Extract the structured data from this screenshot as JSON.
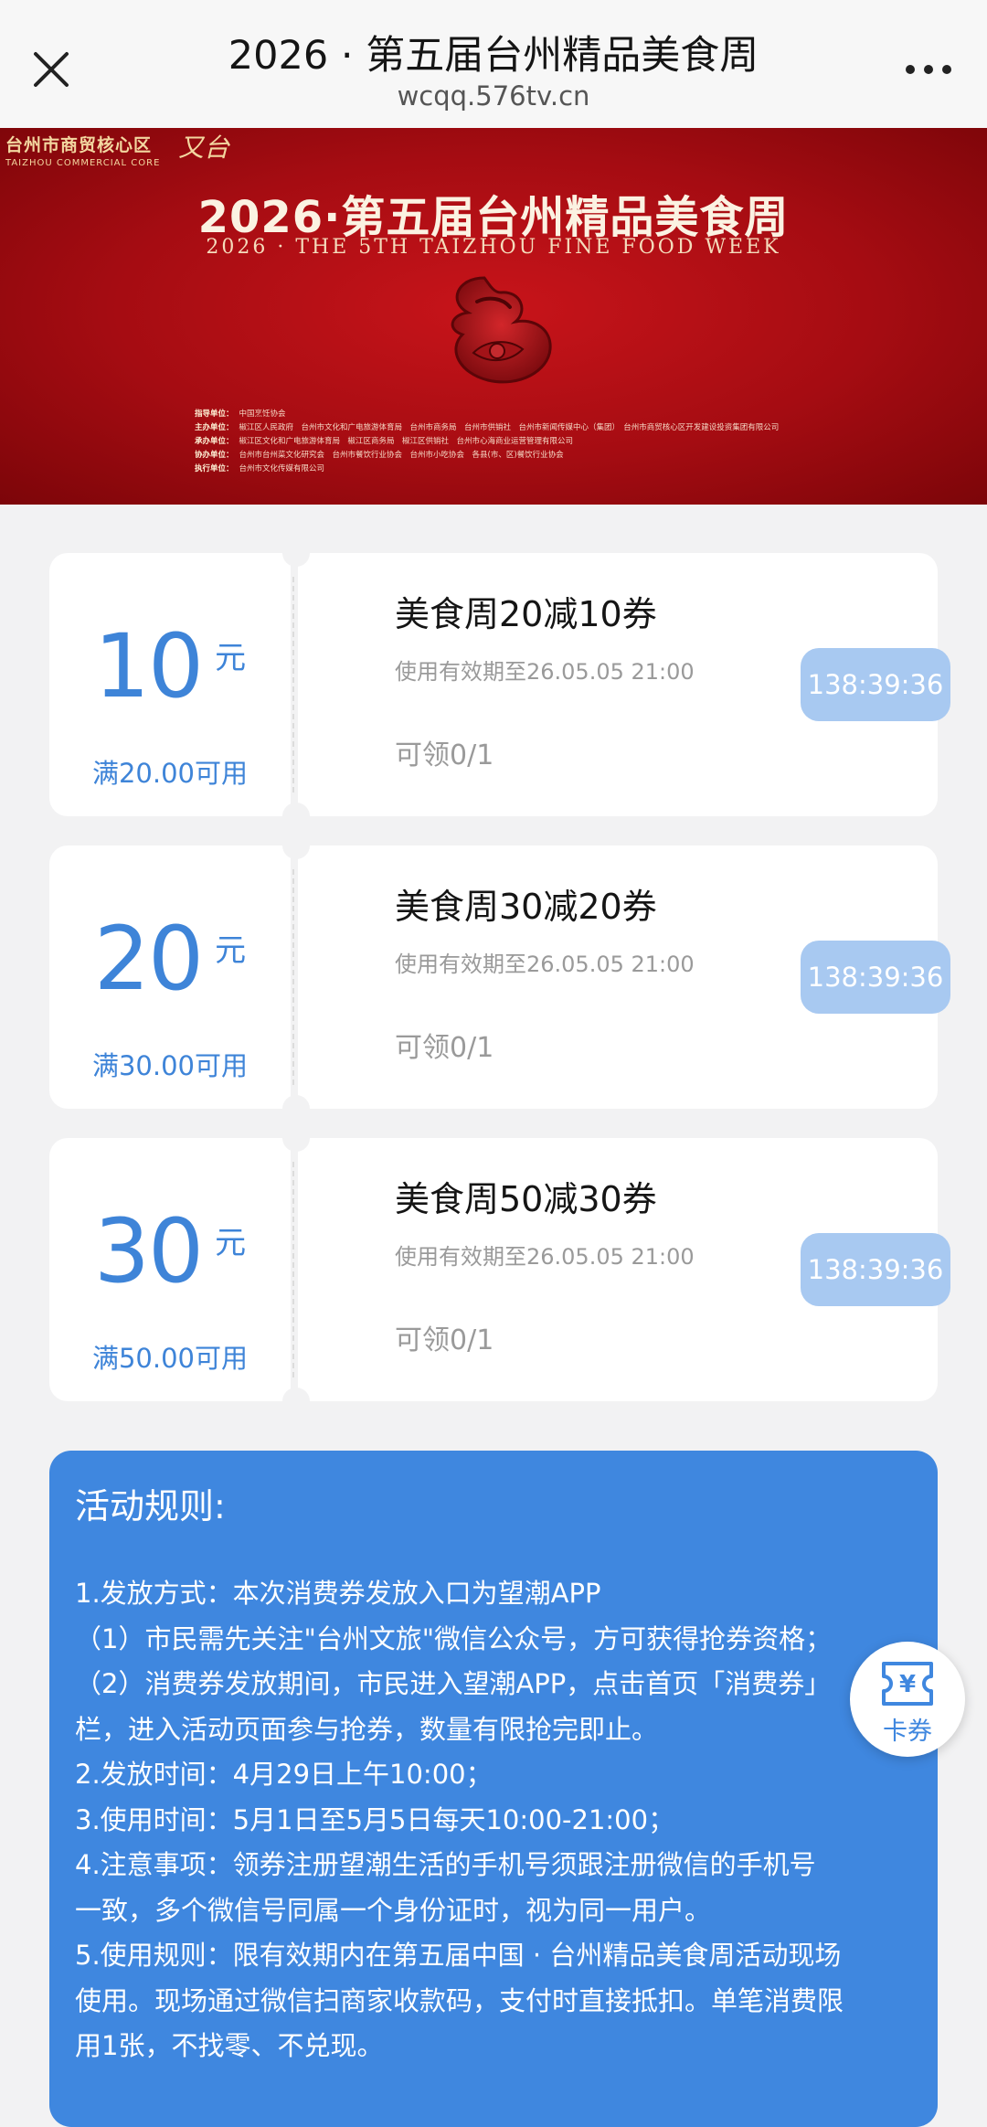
{
  "nav": {
    "title": "2026 · 第五届台州精品美食周",
    "url": "wcqq.576tv.cn"
  },
  "banner": {
    "logo_cn": "台州市商贸核心区",
    "logo_en": "TAIZHOU COMMERCIAL CORE",
    "logo_script": "又台",
    "title": "2026·第五届台州精品美食周",
    "subtitle": "2026 · THE 5TH TAIZHOU FINE FOOD WEEK",
    "credits": [
      {
        "role": "指导单位：",
        "text": "中国烹饪协会"
      },
      {
        "role": "主办单位：",
        "text": "椒江区人民政府　台州市文化和广电旅游体育局　台州市商务局　台州市供销社　台州市新闻传媒中心（集团）　台州市商贸核心区开发建设投资集团有限公司"
      },
      {
        "role": "承办单位：",
        "text": "椒江区文化和广电旅游体育局　椒江区商务局　椒江区供销社　台州市心海商业运营管理有限公司"
      },
      {
        "role": "协办单位：",
        "text": "台州市台州菜文化研究会　台州市餐饮行业协会　台州市小吃协会　各县(市、区)餐饮行业协会"
      },
      {
        "role": "执行单位：",
        "text": "台州市文化传媒有限公司"
      }
    ]
  },
  "coupons": [
    {
      "amount": "10",
      "unit": "元",
      "condition": "满20.00可用",
      "name": "美食周20减10券",
      "valid": "使用有效期至26.05.05 21:00",
      "claim": "可领0/1",
      "timer": "138:39:36"
    },
    {
      "amount": "20",
      "unit": "元",
      "condition": "满30.00可用",
      "name": "美食周30减20券",
      "valid": "使用有效期至26.05.05 21:00",
      "claim": "可领0/1",
      "timer": "138:39:36"
    },
    {
      "amount": "30",
      "unit": "元",
      "condition": "满50.00可用",
      "name": "美食周50减30券",
      "valid": "使用有效期至26.05.05 21:00",
      "claim": "可领0/1",
      "timer": "138:39:36"
    }
  ],
  "rules": {
    "title": "活动规则:",
    "lines": [
      "1.发放方式：本次消费券发放入口为望潮APP",
      "（1）市民需先关注\"台州文旅\"微信公众号，方可获得抢券资格；",
      "（2）消费券发放期间，市民进入望潮APP，点击首页「消费券」",
      "栏，进入活动页面参与抢券，数量有限抢完即止。",
      "2.发放时间：4月29日上午10:00；",
      "3.使用时间：5月1日至5月5日每天10:00-21:00；",
      "4.注意事项：领券注册望潮生活的手机号须跟注册微信的手机号",
      "一致，多个微信号同属一个身份证时，视为同一用户。",
      "5.使用规则：限有效期内在第五届中国 · 台州精品美食周活动现场",
      "使用。现场通过微信扫商家收款码，支付时直接抵扣。单笔消费限",
      "用1张，不找零、不兑现。"
    ]
  },
  "fab": {
    "label": "卡券",
    "icon_char": "¥"
  },
  "colors": {
    "accent": "#3e84d8",
    "timer_bg": "#a8c9f1",
    "rules_bg": "#3f87df",
    "banner_red": "#b30e14"
  }
}
